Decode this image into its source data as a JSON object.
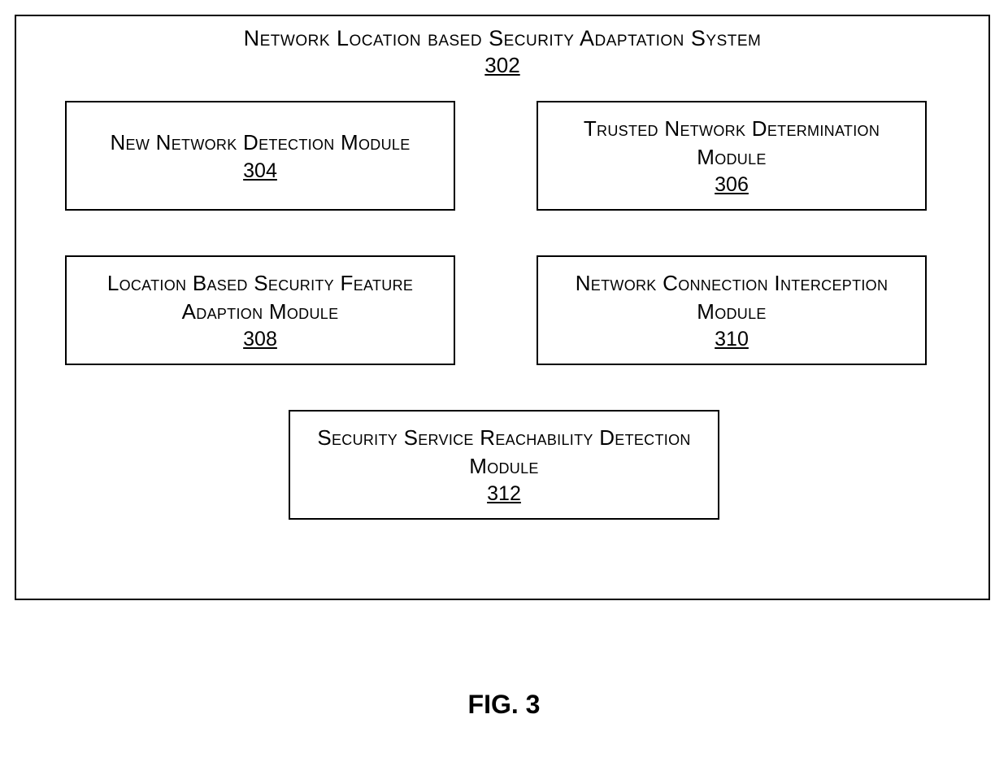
{
  "system": {
    "title": "Network Location based Security Adaptation System",
    "ref": "302"
  },
  "modules": {
    "m304": {
      "title": "New Network Detection Module",
      "ref": "304"
    },
    "m306": {
      "title": "Trusted Network Determination Module",
      "ref": "306"
    },
    "m308": {
      "title": "Location Based Security Feature Adaption Module",
      "ref": "308"
    },
    "m310": {
      "title": "Network Connection Interception Module",
      "ref": "310"
    },
    "m312": {
      "title": "Security Service Reachability Detection Module",
      "ref": "312"
    }
  },
  "figure": {
    "caption": "FIG. 3"
  }
}
